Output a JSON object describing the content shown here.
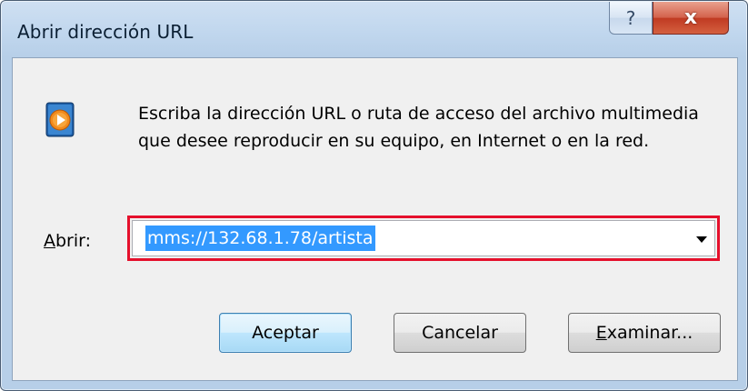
{
  "window": {
    "title": "Abrir dirección URL",
    "help_label": "?",
    "close_label": "x"
  },
  "dialog": {
    "message": "Escriba la dirección URL o ruta de acceso del archivo multimedia que desee reproducir en su equipo, en Internet o en la red.",
    "open_label_access_key": "A",
    "open_label_rest": "brir:",
    "url_value": "mms://132.68.1.78/artista",
    "icon": "media-player-icon"
  },
  "buttons": {
    "accept": "Aceptar",
    "cancel": "Cancelar",
    "browse_access_key": "E",
    "browse_rest": "xaminar..."
  },
  "colors": {
    "highlight_outline": "#e5102c",
    "selection": "#3399ff",
    "close_button": "#c03a22",
    "media_icon": "#f28a1c"
  }
}
